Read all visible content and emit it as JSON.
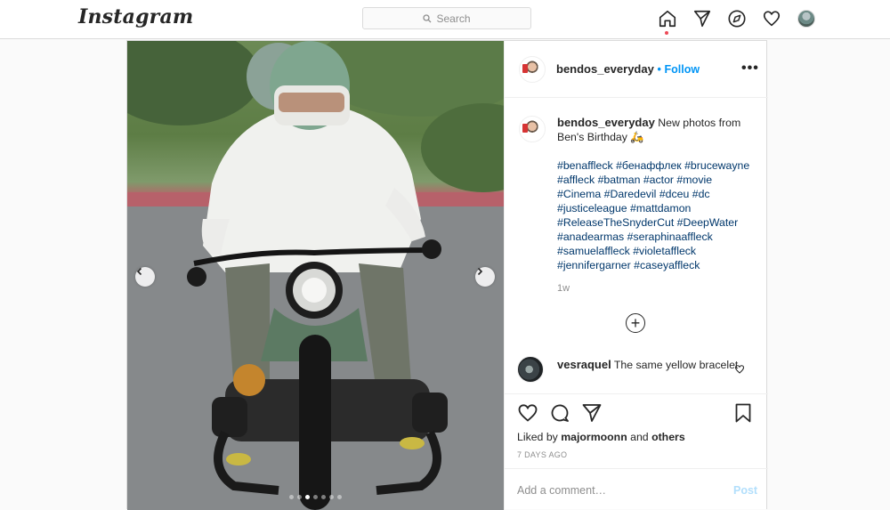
{
  "nav": {
    "logo": "Instagram",
    "search_placeholder": "Search",
    "icons": [
      "home-icon",
      "direct-icon",
      "explore-icon",
      "activity-heart-icon",
      "profile-avatar"
    ],
    "accent_dot_color": "#ed4956"
  },
  "post": {
    "author": "bendos_everyday",
    "follow_separator": "•",
    "follow_label": "Follow",
    "more_label": "•••",
    "caption": {
      "text": "New photos from Ben's Birthday 🛵",
      "tags": "#benaffleck #бенаффлек #brucewayne #affleck #batman #actor #movie #Cinema #Daredevil #dceu #dc #justiceleague #mattdamon #ReleaseTheSnyderCut #DeepWater #anadearmas #seraphinaaffleck #samuelaffleck #violetaffleck #jennifergarner #caseyaffleck"
    },
    "caption_time": "1w",
    "load_more_label": "+",
    "comments": [
      {
        "user": "vesraquel",
        "text": "The same yellow bracelet"
      }
    ],
    "liked_by_prefix": "Liked by",
    "liked_by_user": "majormoonn",
    "liked_by_and": "and",
    "liked_by_others": "others",
    "date": "7 DAYS AGO",
    "add_comment_placeholder": "Add a comment…",
    "post_button": "Post",
    "carousel": {
      "total": 7,
      "active_index": 2
    }
  },
  "colors": {
    "link": "#0095f6",
    "hashtag": "#00376b",
    "muted": "#8e8e8e",
    "post_disabled": "#b2dffc",
    "border": "#dbdbdb"
  }
}
